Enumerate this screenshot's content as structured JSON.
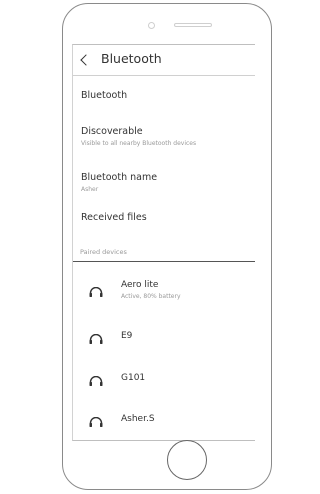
{
  "screen_title": "Bluetooth",
  "settings": [
    {
      "title": "Bluetooth",
      "subtitle": ""
    },
    {
      "title": "Discoverable",
      "subtitle": "Visible to all nearby Bluetooth devices"
    },
    {
      "title": "Bluetooth name",
      "subtitle": "Asher"
    },
    {
      "title": "Received files",
      "subtitle": ""
    }
  ],
  "paired_header": "Paired devices",
  "devices": [
    {
      "name": "Aero lite",
      "status": "Active, 80% battery",
      "icon": "headphones-icon"
    },
    {
      "name": "E9",
      "status": "",
      "icon": "headphones-icon"
    },
    {
      "name": "G101",
      "status": "",
      "icon": "headphones-icon"
    },
    {
      "name": "Asher.S",
      "status": "",
      "icon": "headphones-icon"
    }
  ]
}
